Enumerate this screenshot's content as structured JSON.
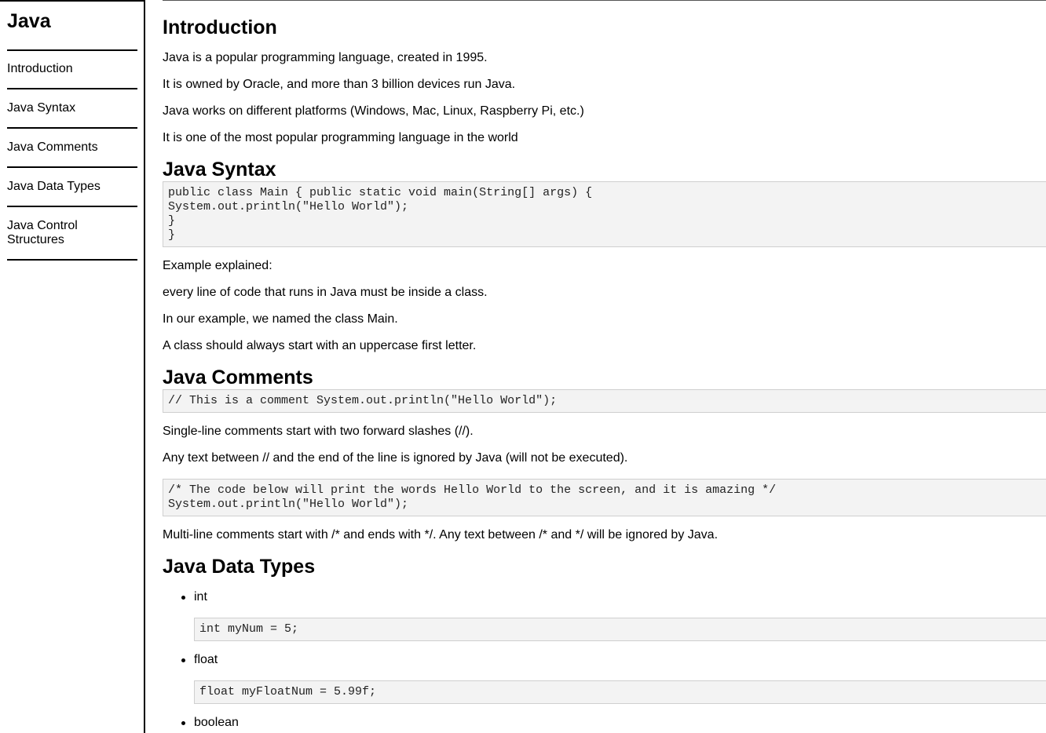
{
  "sidebar": {
    "title": "Java",
    "links": [
      "Introduction",
      "Java Syntax",
      "Java Comments",
      "Java Data Types",
      "Java Control Structures"
    ]
  },
  "intro": {
    "heading": "Introduction",
    "paragraphs": [
      "Java is a popular programming language, created in 1995.",
      "It is owned by Oracle, and more than 3 billion devices run Java.",
      "Java works on different platforms (Windows, Mac, Linux, Raspberry Pi, etc.)",
      "It is one of the most popular programming language in the world"
    ]
  },
  "syntax": {
    "heading": "Java Syntax",
    "code": "public class Main { public static void main(String[] args) {\nSystem.out.println(\"Hello World\");\n}\n}",
    "paragraphs": [
      "Example explained:",
      "every line of code that runs in Java must be inside a class.",
      "In our example, we named the class Main.",
      "A class should always start with an uppercase first letter."
    ]
  },
  "comments": {
    "heading": "Java Comments",
    "code1": "// This is a comment System.out.println(\"Hello World\");",
    "paragraphs": [
      "Single-line comments start with two forward slashes (//).",
      "Any text between // and the end of the line is ignored by Java (will not be executed)."
    ],
    "code2": "/* The code below will print the words Hello World to the screen, and it is amazing */\nSystem.out.println(\"Hello World\");",
    "paragraph3": "Multi-line comments start with /* and ends with */. Any text between /* and */ will be ignored by Java."
  },
  "datatypes": {
    "heading": "Java Data Types",
    "items": [
      {
        "label": "int",
        "code": "int myNum = 5;"
      },
      {
        "label": "float",
        "code": "float myFloatNum = 5.99f;"
      },
      {
        "label": "boolean",
        "code": ""
      }
    ]
  }
}
